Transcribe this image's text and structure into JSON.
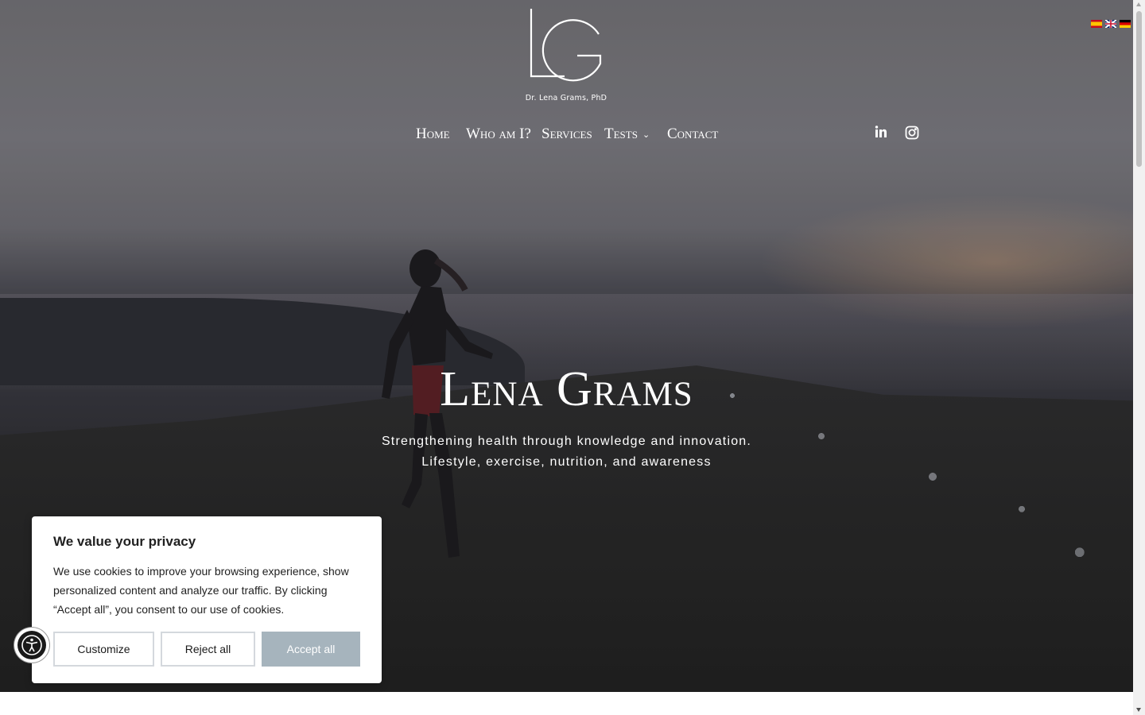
{
  "header": {
    "logo_caption": "Dr. Lena Grams, PhD",
    "nav": [
      {
        "label": "Home"
      },
      {
        "label": "Who am I?"
      },
      {
        "label": "Services"
      },
      {
        "label": "Tests",
        "has_dropdown": true
      },
      {
        "label": "Contact"
      }
    ],
    "social": {
      "icons": [
        "linkedin-icon",
        "instagram-icon"
      ]
    },
    "languages": [
      "Spanish",
      "English",
      "German"
    ]
  },
  "hero": {
    "title": "Lena Grams",
    "subtitle_line1": "Strengthening health through knowledge and innovation.",
    "subtitle_line2": "Lifestyle, exercise, nutrition, and awareness"
  },
  "cookie_banner": {
    "title": "We value your privacy",
    "text": "We use cookies to improve your browsing experience, show personalized content and analyze our traffic. By clicking “Accept all”, you consent to our use of cookies.",
    "customize_label": "Customize",
    "reject_label": "Reject all",
    "accept_label": "Accept all"
  },
  "accessibility": {
    "icon": "accessibility-icon"
  },
  "colors": {
    "accept_button": "#a6b4bd",
    "nav_text": "#ffffff"
  }
}
